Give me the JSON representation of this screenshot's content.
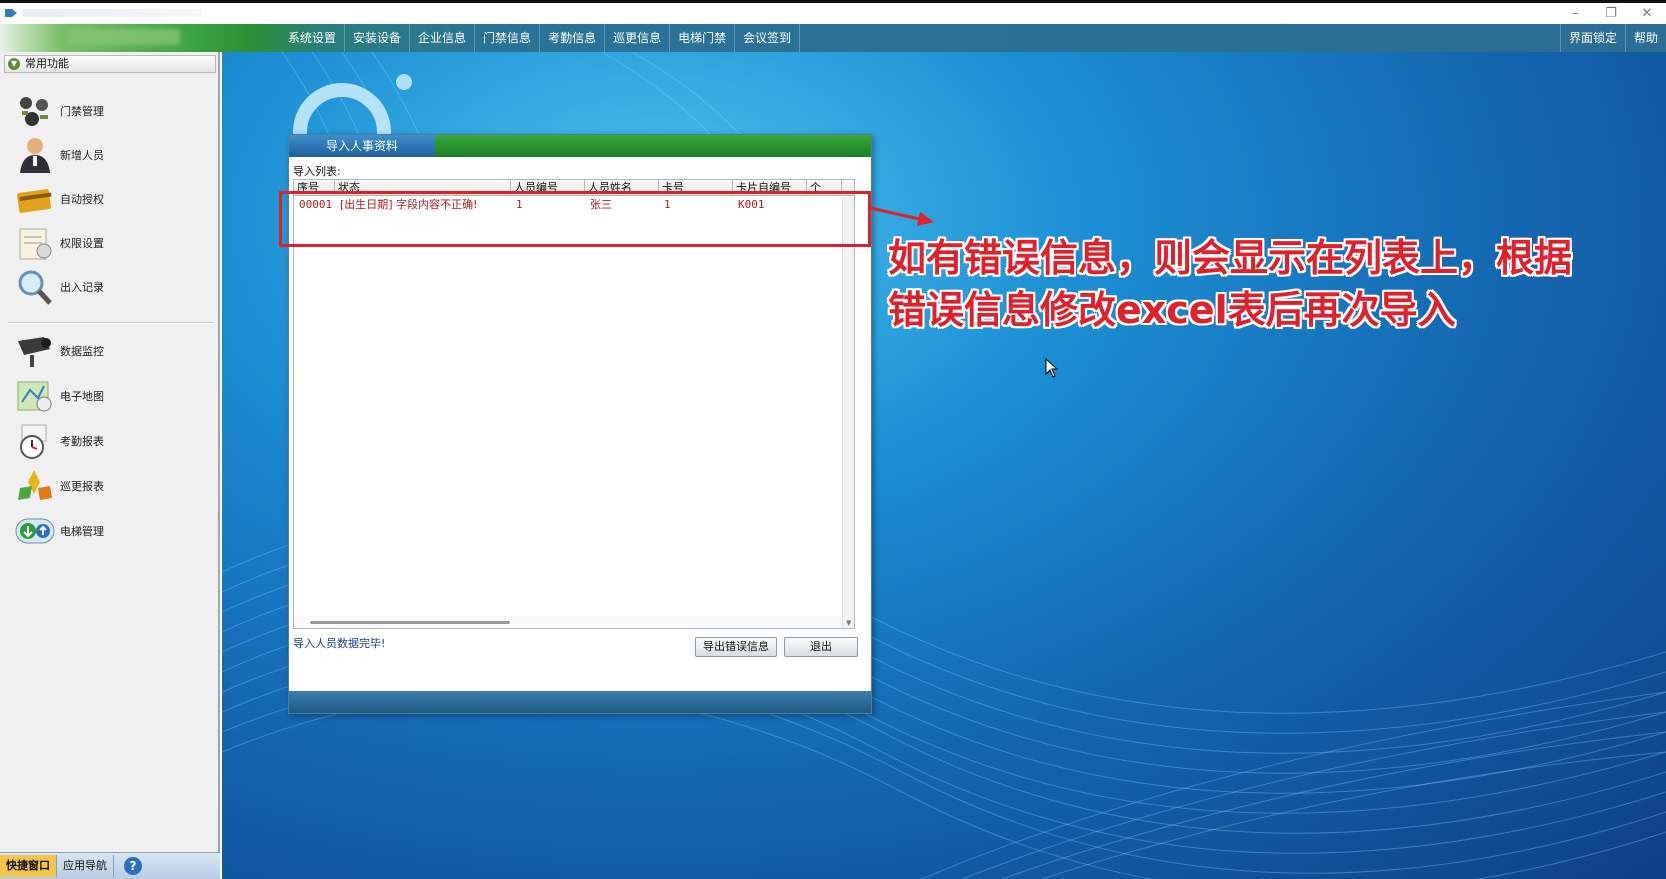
{
  "window": {
    "controls": {
      "minimize": "–",
      "restore": "❐",
      "close": "✕"
    }
  },
  "menu": {
    "items": [
      "系统设置",
      "安装设备",
      "企业信息",
      "门禁信息",
      "考勤信息",
      "巡更信息",
      "电梯门禁",
      "会议签到"
    ],
    "right_items": [
      "界面锁定",
      "帮助"
    ]
  },
  "sidebar": {
    "header": "常用功能",
    "items": [
      {
        "label": "门禁管理",
        "icon": "access-control-icon"
      },
      {
        "label": "新增人员",
        "icon": "person-icon"
      },
      {
        "label": "自动授权",
        "icon": "card-icon"
      },
      {
        "label": "权限设置",
        "icon": "permission-icon"
      },
      {
        "label": "出入记录",
        "icon": "magnifier-icon"
      },
      {
        "label": "数据监控",
        "icon": "camera-icon"
      },
      {
        "label": "电子地图",
        "icon": "map-icon"
      },
      {
        "label": "考勤报表",
        "icon": "clock-icon"
      },
      {
        "label": "巡更报表",
        "icon": "patrol-icon"
      },
      {
        "label": "电梯管理",
        "icon": "elevator-icon"
      }
    ],
    "bottom_tabs": [
      "快捷窗口",
      "应用导航"
    ],
    "help_glyph": "?"
  },
  "dialog": {
    "tab_title": "导入人事资料",
    "list_label": "导入列表:",
    "columns": [
      "序号",
      "状态",
      "人员编号",
      "人员姓名",
      "卡号",
      "卡片自编号",
      "个"
    ],
    "rows": [
      [
        "00001",
        "[出生日期] 字段内容不正确!",
        "1",
        "张三",
        "1",
        "K001"
      ]
    ],
    "status": "导入人员数据完毕!",
    "buttons": {
      "export_errors": "导出错误信息",
      "exit": "退出"
    }
  },
  "annotation": {
    "text_line1": "如有错误信息，则会显示在列表上，根据",
    "text_line2": "错误信息修改excel表后再次导入"
  },
  "colors": {
    "accent_red": "#e0202a",
    "menubar": "#2a6d95",
    "desktop": "#1466b0"
  }
}
